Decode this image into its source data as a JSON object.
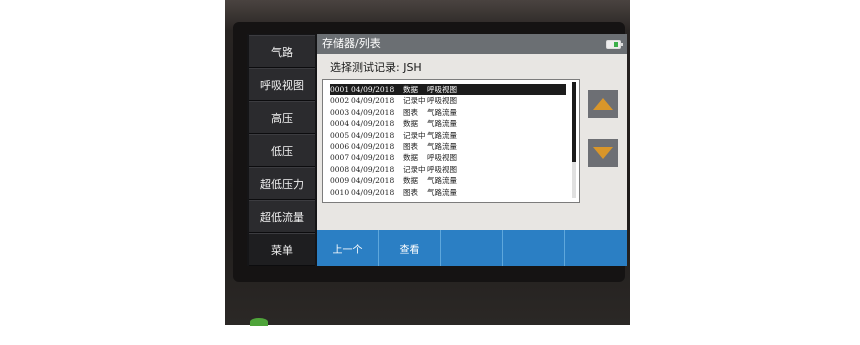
{
  "sidebar": {
    "items": [
      {
        "label": "气路"
      },
      {
        "label": "呼吸视图"
      },
      {
        "label": "高压"
      },
      {
        "label": "低压"
      },
      {
        "label": "超低压力"
      },
      {
        "label": "超低流量"
      },
      {
        "label": "菜单"
      }
    ]
  },
  "header": {
    "title": "存储器/列表",
    "battery_icon": "battery-icon"
  },
  "main": {
    "subtitle": "选择测试记录: JSH",
    "records": [
      {
        "id": "0001",
        "date": "04/09/2018",
        "type": "数据",
        "view": "呼吸视图"
      },
      {
        "id": "0002",
        "date": "04/09/2018",
        "type": "记录中",
        "view": "呼吸视图"
      },
      {
        "id": "0003",
        "date": "04/09/2018",
        "type": "图表",
        "view": "气路流量"
      },
      {
        "id": "0004",
        "date": "04/09/2018",
        "type": "数据",
        "view": "气路流量"
      },
      {
        "id": "0005",
        "date": "04/09/2018",
        "type": "记录中",
        "view": "气路流量"
      },
      {
        "id": "0006",
        "date": "04/09/2018",
        "type": "图表",
        "view": "气路流量"
      },
      {
        "id": "0007",
        "date": "04/09/2018",
        "type": "数据",
        "view": "呼吸视图"
      },
      {
        "id": "0008",
        "date": "04/09/2018",
        "type": "记录中",
        "view": "呼吸视图"
      },
      {
        "id": "0009",
        "date": "04/09/2018",
        "type": "数据",
        "view": "气路流量"
      },
      {
        "id": "0010",
        "date": "04/09/2018",
        "type": "图表",
        "view": "气路流量"
      }
    ],
    "selected_index": 0,
    "scroll_up_icon": "triangle-up-icon",
    "scroll_down_icon": "triangle-down-icon"
  },
  "bottombar": {
    "buttons": [
      {
        "label": "上一个"
      },
      {
        "label": "查看"
      },
      {
        "label": ""
      },
      {
        "label": ""
      },
      {
        "label": ""
      }
    ]
  },
  "colors": {
    "accent": "#2b7fc4",
    "arrow": "#d9962a",
    "titlebar": "#6b6f73",
    "battery": "#3cb04a"
  }
}
